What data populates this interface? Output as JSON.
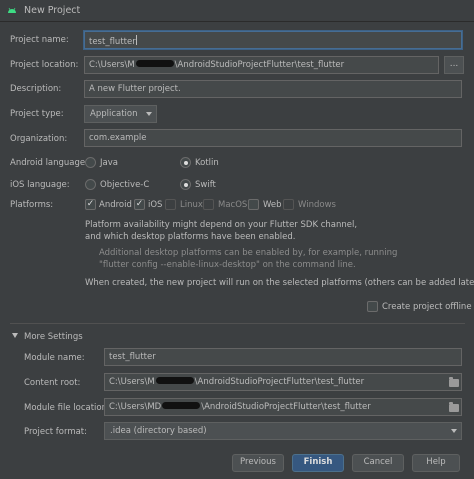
{
  "window": {
    "title": "New Project"
  },
  "form": {
    "project_name": {
      "label": "Project name:",
      "value": "test_flutter"
    },
    "project_location": {
      "label": "Project location:",
      "value_prefix": "C:\\Users\\M",
      "value_suffix": "\\AndroidStudioProjectFlutter\\test_flutter",
      "browse": "..."
    },
    "description": {
      "label": "Description:",
      "value": "A new Flutter project."
    },
    "project_type": {
      "label": "Project type:",
      "selected": "Application"
    },
    "organization": {
      "label": "Organization:",
      "value": "com.example"
    },
    "android_language": {
      "label": "Android language:",
      "options": [
        "Java",
        "Kotlin"
      ],
      "selected": "Kotlin"
    },
    "ios_language": {
      "label": "iOS language:",
      "options": [
        "Objective-C",
        "Swift"
      ],
      "selected": "Swift"
    },
    "platforms": {
      "label": "Platforms:",
      "items": [
        {
          "name": "Android",
          "checked": true
        },
        {
          "name": "iOS",
          "checked": true
        },
        {
          "name": "Linux",
          "checked": false
        },
        {
          "name": "MacOS",
          "checked": false
        },
        {
          "name": "Web",
          "checked": false
        },
        {
          "name": "Windows",
          "checked": false
        }
      ]
    },
    "notes": {
      "line1": "Platform availability might depend on your Flutter SDK channel,",
      "line2": "and which desktop platforms have been enabled.",
      "line3": "Additional desktop platforms can be enabled by, for example, running",
      "line4": "\"flutter config --enable-linux-desktop\" on the command line.",
      "line5": "When created, the new project will run on the selected platforms (others can be added later)."
    },
    "create_offline": {
      "label": "Create project offline",
      "checked": false
    }
  },
  "more_settings": {
    "title": "More Settings",
    "module_name": {
      "label": "Module name:",
      "value": "test_flutter"
    },
    "content_root": {
      "label": "Content root:",
      "value_prefix": "C:\\Users\\M",
      "value_suffix": "\\AndroidStudioProjectFlutter\\test_flutter"
    },
    "module_file_location": {
      "label": "Module file location:",
      "value_prefix": "C:\\Users\\MD",
      "value_suffix": "\\AndroidStudioProjectFlutter\\test_flutter"
    },
    "project_format": {
      "label": "Project format:",
      "selected": ".idea (directory based)"
    }
  },
  "buttons": {
    "previous": "Previous",
    "finish": "Finish",
    "cancel": "Cancel",
    "help": "Help"
  },
  "colors": {
    "background": "#3c3f41",
    "field": "#45494a",
    "primary_button": "#365880",
    "android_green": "#3ddc84"
  }
}
